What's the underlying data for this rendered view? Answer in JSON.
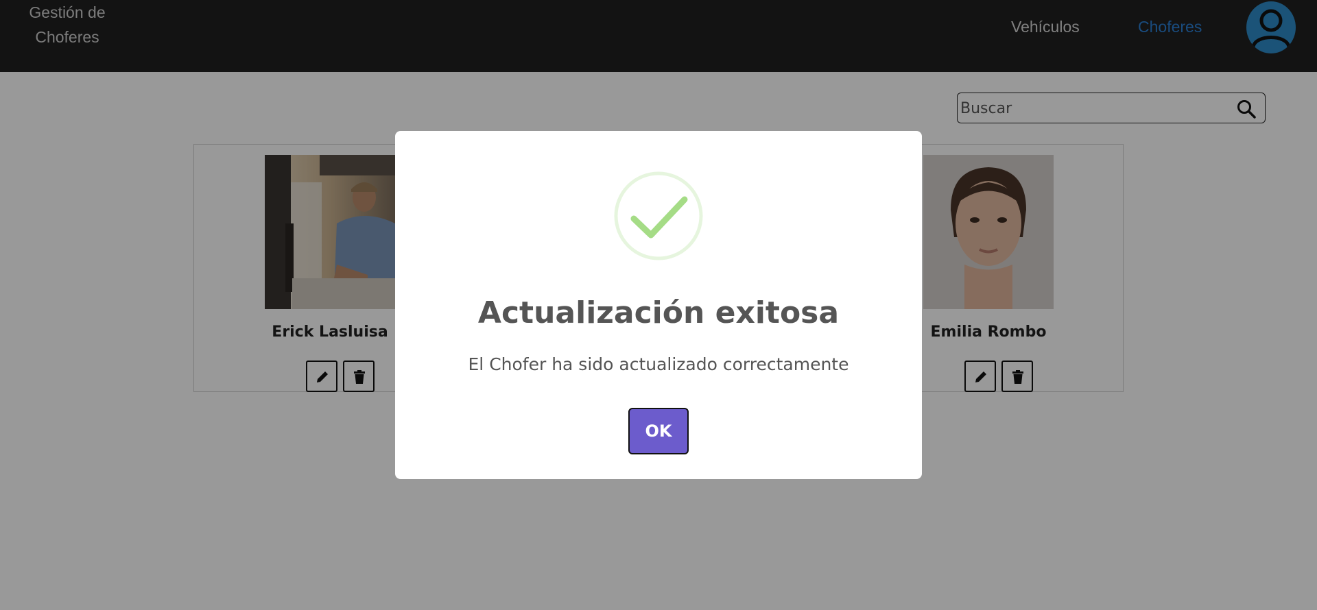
{
  "navbar": {
    "brand": "Gestión de\nChoferes",
    "links": [
      "Vehículos",
      "Choferes"
    ],
    "active_link": "Choferes"
  },
  "search": {
    "placeholder": "Buscar"
  },
  "drivers": [
    {
      "name": "Erick Lasluisa"
    },
    {
      "name": "Emilia Rombo"
    }
  ],
  "dialog": {
    "title": "Actualización exitosa",
    "message": "El Chofer ha sido actualizado correctamente",
    "ok_label": "OK",
    "icon": "success-check-icon"
  },
  "colors": {
    "navbar_bg": "#212121",
    "active_link": "#2b7fd4",
    "ok_button": "#6c5ccc",
    "success_check": "#a5dc86"
  }
}
